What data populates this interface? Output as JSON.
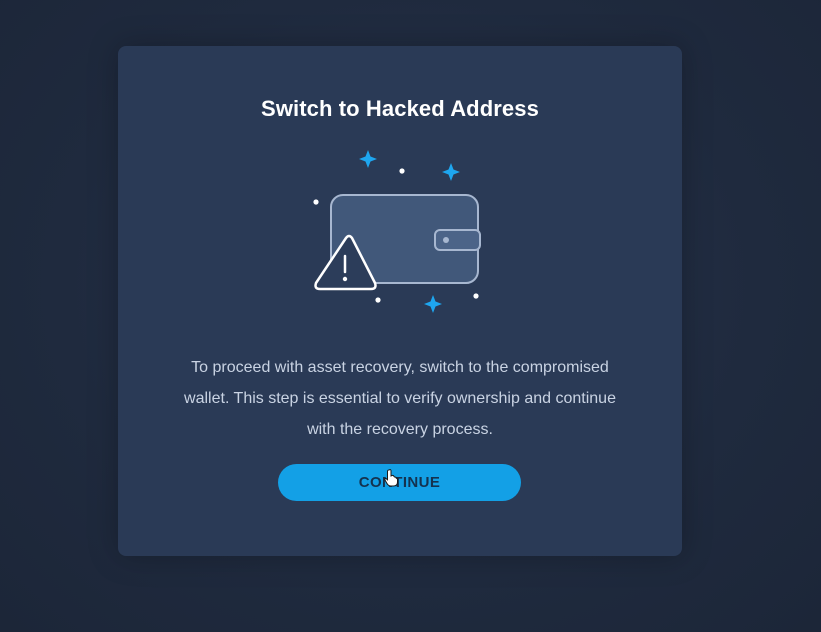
{
  "modal": {
    "title": "Switch to Hacked Address",
    "message": "To proceed with asset recovery, switch to the compromised wallet. This step is essential to verify ownership and continue with the recovery process.",
    "continue_label": "CONTINUE"
  },
  "illustration": {
    "icons": [
      "wallet-icon",
      "warning-triangle-icon",
      "sparkle-icon"
    ]
  },
  "colors": {
    "background": "#1f2a3e",
    "modal": "#2a3a56",
    "accent": "#13a0e6",
    "title": "#ffffff",
    "body_text": "#c9d3e3"
  }
}
